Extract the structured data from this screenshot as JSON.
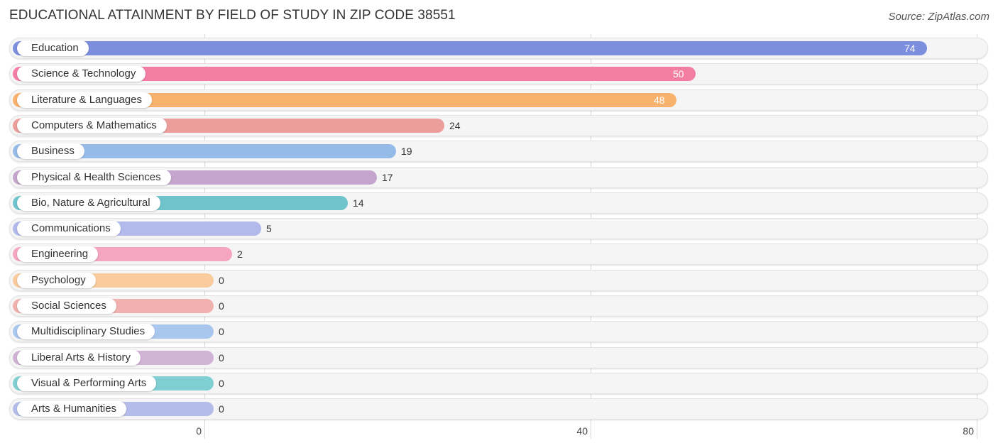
{
  "title": "EDUCATIONAL ATTAINMENT BY FIELD OF STUDY IN ZIP CODE 38551",
  "source": "Source: ZipAtlas.com",
  "chart_data": {
    "type": "bar",
    "orientation": "horizontal",
    "title": "EDUCATIONAL ATTAINMENT BY FIELD OF STUDY IN ZIP CODE 38551",
    "xlabel": "",
    "ylabel": "",
    "xlim": [
      0,
      80
    ],
    "ticks": [
      0,
      40,
      80
    ],
    "tick_labels": [
      "0",
      "40",
      "80"
    ],
    "grid": true,
    "categories": [
      "Education",
      "Science & Technology",
      "Literature & Languages",
      "Computers & Mathematics",
      "Business",
      "Physical & Health Sciences",
      "Bio, Nature & Agricultural",
      "Communications",
      "Engineering",
      "Psychology",
      "Social Sciences",
      "Multidisciplinary Studies",
      "Liberal Arts & History",
      "Visual & Performing Arts",
      "Arts & Humanities"
    ],
    "values": [
      74,
      50,
      48,
      24,
      19,
      17,
      14,
      5,
      2,
      0,
      0,
      0,
      0,
      0,
      0
    ],
    "value_labels": [
      "74",
      "50",
      "48",
      "24",
      "19",
      "17",
      "14",
      "5",
      "2",
      "0",
      "0",
      "0",
      "0",
      "0",
      "0"
    ],
    "colors": [
      "#7b8fde",
      "#f47ea3",
      "#f9b26c",
      "#eb9e9c",
      "#97bbe8",
      "#c5a5cd",
      "#6fc4cc",
      "#b2baec",
      "#f5a5bf",
      "#f9cb9d",
      "#f1b1ae",
      "#a9c6ee",
      "#d1b3d6",
      "#7fcfd2",
      "#b4bdea"
    ]
  }
}
